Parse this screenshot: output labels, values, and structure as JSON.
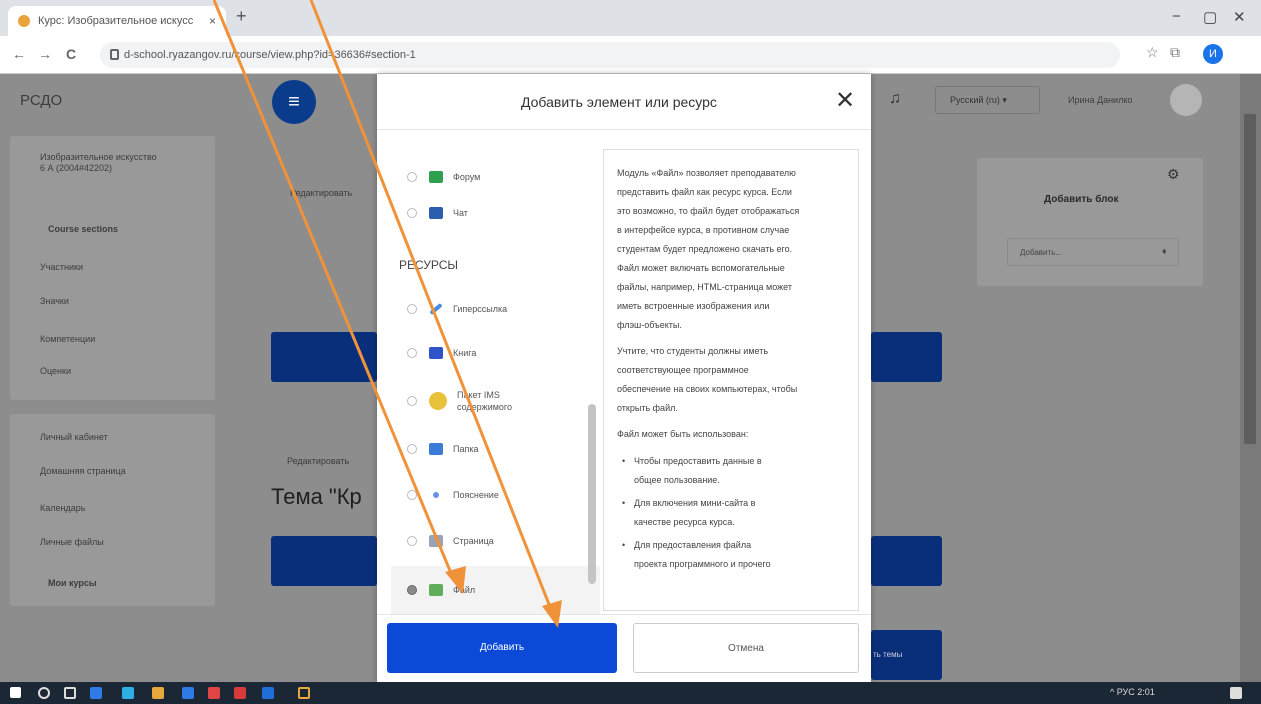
{
  "browser": {
    "tab_title": "Курс: Изобразительное искусс",
    "tab_close": "×",
    "new_tab": "+",
    "url": "d-school.ryazangov.ru/course/view.php?id=36636#section-1",
    "back": "←",
    "forward": "→",
    "reload": "C",
    "min": "−",
    "max": "▢",
    "close": "✕",
    "profile_initial": "И"
  },
  "site": {
    "brand": "РСДО",
    "menu_glyph": "≡",
    "language": "Русский (ru) ▾",
    "user_name": "Ирина Данилко",
    "sidebar": {
      "course_name": "Изобразительное искусство 6 А (2004#42202)",
      "course_sections": "Course sections",
      "participants": "Участники",
      "badges": "Значки",
      "competencies": "Компетенции",
      "grades": "Оценки",
      "dashboard": "Личный кабинет",
      "home": "Домашняя страница",
      "calendar": "Календарь",
      "files": "Личные файлы",
      "my_courses": "Мои курсы"
    },
    "edit_label_1": "Редактировать",
    "edit_label_2": "Редактировать",
    "topic_title": "Тема \"Кр",
    "add_block_title": "Добавить блок",
    "add_block_select": "Добавить...",
    "theme_btn_fragment": "ть темы"
  },
  "modal": {
    "title": "Добавить элемент или ресурс",
    "close": "✕",
    "items_top": [
      {
        "label": "Форум",
        "color": "#2e9e4f"
      },
      {
        "label": "Чат",
        "color": "#2b5fad"
      }
    ],
    "section_label": "РЕСУРСЫ",
    "resources": [
      {
        "label": "Гиперссылка",
        "color": "#4a8de0"
      },
      {
        "label": "Книга",
        "color": "#2f54c9"
      },
      {
        "label": "Пакет IMS содержимого",
        "color": "#e8c23a"
      },
      {
        "label": "Папка",
        "color": "#3a7bd5"
      },
      {
        "label": "Пояснение",
        "color": "#6a8fe8"
      },
      {
        "label": "Страница",
        "color": "#9aa3b5"
      },
      {
        "label": "Файл",
        "color": "#5fae5a"
      }
    ],
    "help_paragraphs": [
      "Модуль «Файл» позволяет преподавателю",
      "представить файл как ресурс курса. Если",
      "это возможно, то файл будет отображаться",
      "в интерфейсе курса, в противном случае",
      "студентам будет предложено скачать его.",
      "Файл может включать вспомогательные",
      "файлы, например, HTML-страница может",
      "иметь встроенные изображения или",
      "флэш-объекты.",
      "Учтите, что студенты должны иметь",
      "соответствующее программное",
      "обеспечение на своих компьютерах, чтобы",
      "открыть файл.",
      "Файл может быть использован:"
    ],
    "help_bullets": [
      "Чтобы предоставить данные в",
      "общее пользование.",
      "Для включения мини-сайта в",
      "качестве ресурса курса.",
      "Для предоставления файла",
      "проекта программного и прочего"
    ],
    "add_button": "Добавить",
    "cancel_button": "Отмена"
  },
  "taskbar": {
    "tray_text": "^ РУС  2:01",
    "colors": [
      "#2f7be6",
      "#2eb0e6",
      "#e7a93d",
      "#2f7be6",
      "#e04545",
      "#d83b3b",
      "#1f6fd6",
      "#e8a93a"
    ]
  },
  "annotation": {
    "arrow_color": "#f0923a"
  }
}
